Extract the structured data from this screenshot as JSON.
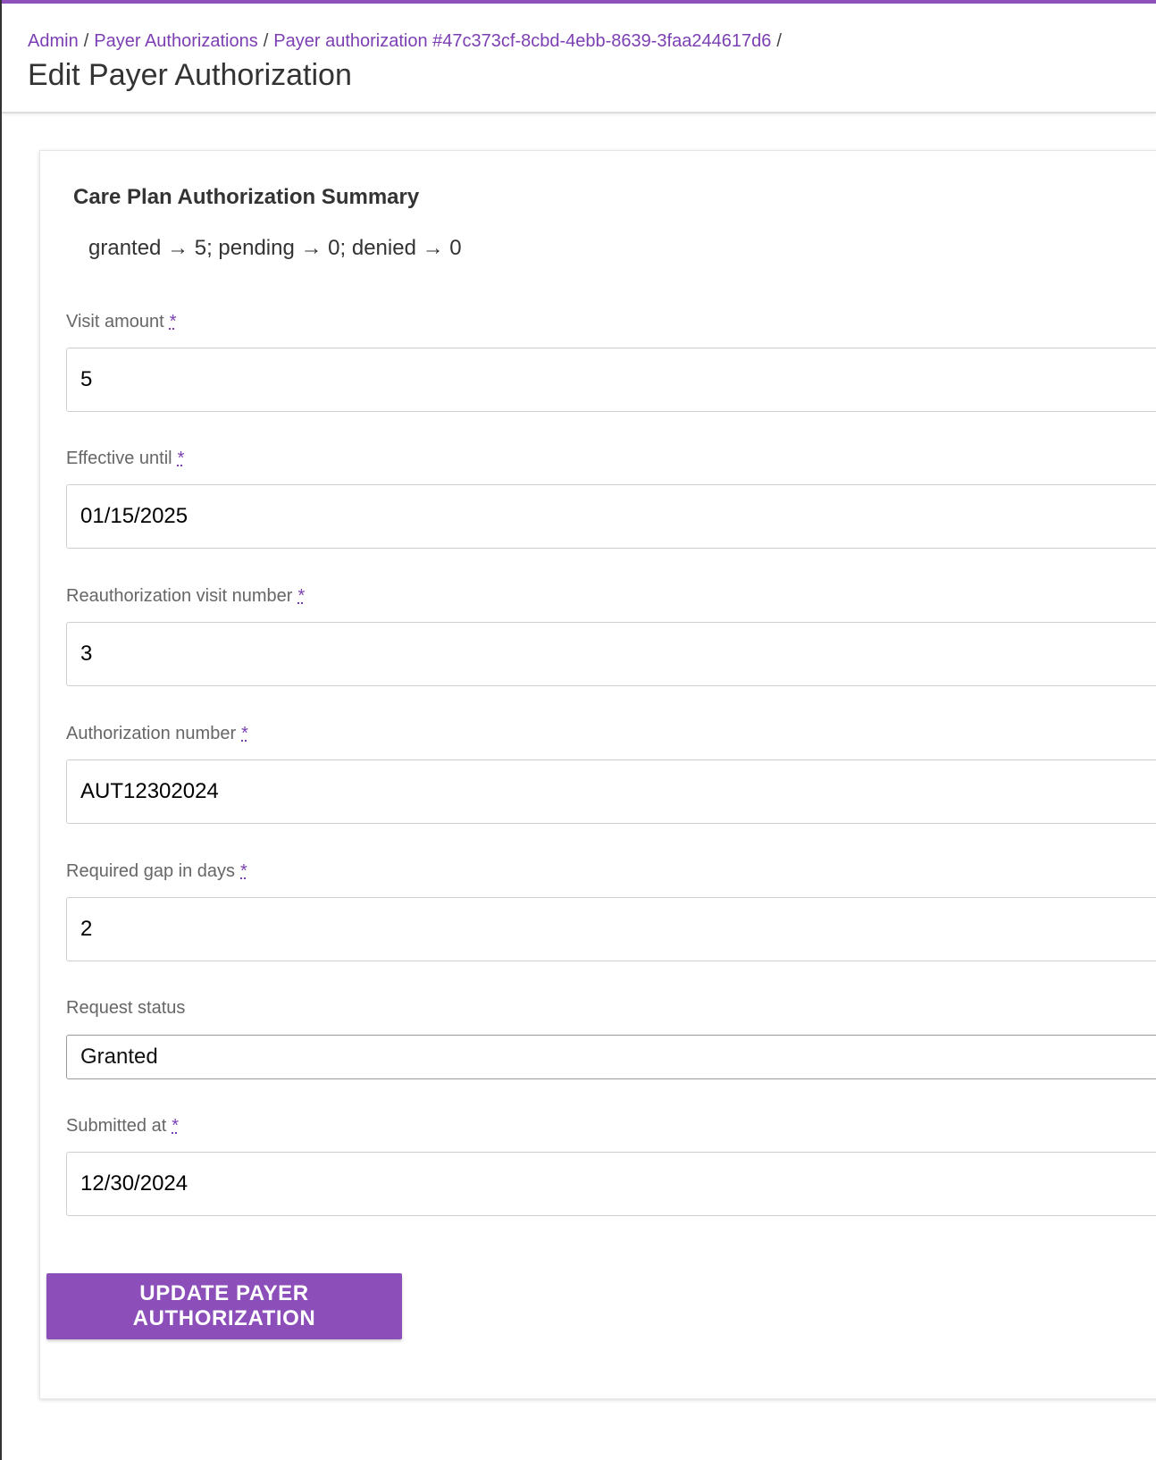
{
  "breadcrumb": {
    "items": [
      "Admin",
      "Payer Authorizations",
      "Payer authorization #47c373cf-8cbd-4ebb-8639-3faa244617d6"
    ],
    "separator": "/"
  },
  "page": {
    "title": "Edit Payer Authorization"
  },
  "summary": {
    "title": "Care Plan Authorization Summary",
    "text": "granted → 5; pending → 0; denied → 0"
  },
  "form": {
    "required_marker": "*",
    "fields": [
      {
        "label": "Visit amount",
        "value": "5",
        "required": true
      },
      {
        "label": "Effective until",
        "value": "01/15/2025",
        "required": true
      },
      {
        "label": "Reauthorization visit number",
        "value": "3",
        "required": true
      },
      {
        "label": "Authorization number",
        "value": "AUT12302024",
        "required": true
      },
      {
        "label": "Required gap in days",
        "value": "2",
        "required": true
      },
      {
        "label": "Request status",
        "value": "Granted",
        "required": false
      },
      {
        "label": "Submitted at",
        "value": "12/30/2024",
        "required": true
      }
    ],
    "submit_label": "Update Payer Authorization"
  },
  "colors": {
    "accent": "#8e50b9",
    "link": "#7b3fb3",
    "highlight": "#e24329"
  }
}
